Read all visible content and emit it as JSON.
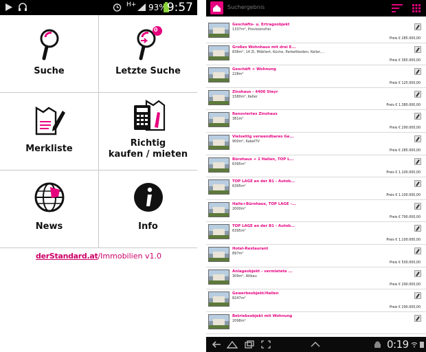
{
  "left_status_bar": {
    "battery_percent": "93%",
    "time": "9:57",
    "network": "H+"
  },
  "menu": {
    "items": [
      {
        "label": "Suche",
        "icon": "search-icon"
      },
      {
        "label": "Letzte Suche",
        "icon": "recent-search-icon",
        "badge": "0"
      },
      {
        "label": "Merkliste",
        "icon": "notepad-icon"
      },
      {
        "label": "Richtig kaufen / mieten",
        "label_line1": "Richtig",
        "label_line2": "kaufen / mieten",
        "icon": "calculator-icon"
      },
      {
        "label": "News",
        "icon": "globe-icon"
      },
      {
        "label": "Info",
        "icon": "info-icon"
      }
    ]
  },
  "footer": {
    "brand": "derStandard.at",
    "section": "/Immobilien",
    "version": "v1.0"
  },
  "tablet_top_bar": {
    "title": "Suchergebnis",
    "accent_color": "#e6007e"
  },
  "results": [
    {
      "name": "Geschäfts- u. Ertragsobjekt",
      "desc": "1337m², Provisionsfrei",
      "price": "Preis € 285.000,00"
    },
    {
      "name": "Großes Wohnhaus mit drei E...",
      "desc": "838m², 14 Zi, Möbliert, Küche, Parkettboden, Keller,...",
      "price": "Preis € 365.000,00"
    },
    {
      "name": "Geschäft + Wohnung",
      "desc": "228m²",
      "price": "Preis € 125.000,00"
    },
    {
      "name": "Zinshaus - 4400 Steyr",
      "desc": "1580m², Keller",
      "price": "Preis € 1.380.000,00"
    },
    {
      "name": "Renoviertes Zinshaus",
      "desc": "381m²",
      "price": "Preis € 290.000,00"
    },
    {
      "name": "Vielseitig verwendbares Ge...",
      "desc": "900m², KabelTV",
      "price": "Preis € 285.000,00"
    },
    {
      "name": "Bürohaus + 2 Hallen, TOP L...",
      "desc": "6395m²",
      "price": "Preis € 1.100.000,00"
    },
    {
      "name": "TOP LAGE an der B1 - Autob...",
      "desc": "6395m²",
      "price": "Preis € 1.100.000,00"
    },
    {
      "name": "Halle+Bürohaus, TOP LAGE -...",
      "desc": "2000m²",
      "price": "Preis € 790.000,00"
    },
    {
      "name": "TOP LAGE an der B1 - Autob...",
      "desc": "6395m²",
      "price": "Preis € 1.100.000,00"
    },
    {
      "name": "Hotel-Restaurant",
      "desc": "897m²",
      "price": "Preis € 500.000,00"
    },
    {
      "name": "Anlageobjekt - vermietete ...",
      "desc": "309m², Altbau",
      "price": "Preis € 290.000,00"
    },
    {
      "name": "Gewerbeobjekt/Hallen",
      "desc": "8247m²",
      "price": "Preis € 290.000,00"
    },
    {
      "name": "Betriebsobjekt mit Wohnung",
      "desc": "2098m²",
      "price": ""
    }
  ],
  "tablet_nav_bar": {
    "time": "0:19"
  }
}
